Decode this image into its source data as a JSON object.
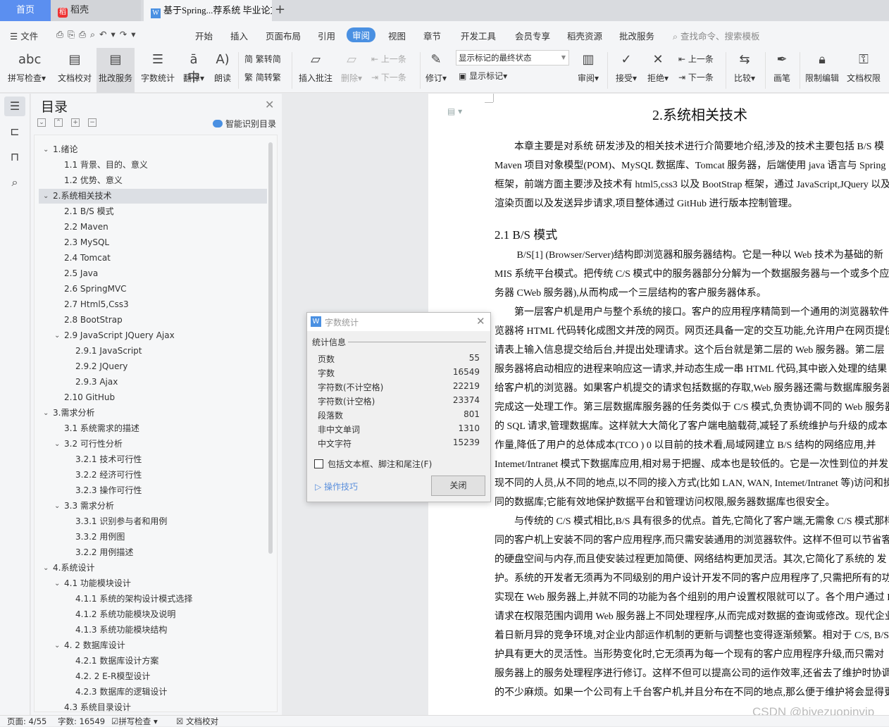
{
  "tabs": {
    "home": "首页",
    "daoke": "稻壳",
    "doc": "基于Spring...荐系统 毕业论文",
    "new": "+"
  },
  "menu": {
    "file": "文件",
    "items": [
      "开始",
      "插入",
      "页面布局",
      "引用",
      "审阅",
      "视图",
      "章节",
      "开发工具",
      "会员专享",
      "稻壳资源",
      "批改服务"
    ],
    "active": "审阅",
    "search": "查找命令、搜索模板"
  },
  "ribbon": {
    "spell": "拼写检查",
    "proof": "文档校对",
    "correct": "批改服务",
    "wordcount": "字数统计",
    "translate": "翻译",
    "read": "朗读",
    "t2s": "繁转简",
    "s2t": "简转繁",
    "insert_comment": "插入批注",
    "delete": "删除",
    "prev_c": "上一条",
    "next_c": "下一条",
    "revise": "修订",
    "markup_state": "显示标记的最终状态",
    "show_markup": "显示标记",
    "review": "审阅",
    "accept": "接受",
    "reject": "拒绝",
    "prev": "上一条",
    "next": "下一条",
    "compare": "比较",
    "pen": "画笔",
    "restrict": "限制编辑",
    "permission": "文档权限"
  },
  "toc": {
    "title": "目录",
    "smart": "智能识别目录",
    "items": [
      {
        "label": "1.绪论",
        "level": 1,
        "expanded": true
      },
      {
        "label": "1.1  背景、目的、意义",
        "level": 2
      },
      {
        "label": "1.2  优势、意义",
        "level": 2
      },
      {
        "label": "2.系统相关技术",
        "level": 1,
        "expanded": true,
        "selected": true
      },
      {
        "label": "2.1 B/S 模式",
        "level": 2
      },
      {
        "label": "2.2 Maven",
        "level": 2
      },
      {
        "label": "2.3 MySQL",
        "level": 2
      },
      {
        "label": "2.4 Tomcat",
        "level": 2
      },
      {
        "label": "2.5 Java",
        "level": 2
      },
      {
        "label": "2.6 SpringMVC",
        "level": 2
      },
      {
        "label": "2.7 Html5,Css3",
        "level": 2
      },
      {
        "label": "2.8 BootStrap",
        "level": 2
      },
      {
        "label": "2.9 JavaScript   JQuery    Ajax",
        "level": 2,
        "expanded": true
      },
      {
        "label": "2.9.1 JavaScript",
        "level": 3
      },
      {
        "label": "2.9.2 JQuery",
        "level": 3
      },
      {
        "label": "2.9.3 Ajax",
        "level": 3
      },
      {
        "label": "2.10 GitHub",
        "level": 2
      },
      {
        "label": "3.需求分析",
        "level": 1,
        "expanded": true
      },
      {
        "label": "3.1  系统需求的描述",
        "level": 2
      },
      {
        "label": "3.2  可行性分析",
        "level": 2,
        "expanded": true
      },
      {
        "label": "3.2.1 技术可行性",
        "level": 3
      },
      {
        "label": "3.2.2 经济可行性",
        "level": 3
      },
      {
        "label": "3.2.3 操作可行性",
        "level": 3
      },
      {
        "label": "3.3  需求分析",
        "level": 2,
        "expanded": true
      },
      {
        "label": "3.3.1  识别参与者和用例",
        "level": 3
      },
      {
        "label": "3.3.2  用例图",
        "level": 3
      },
      {
        "label": "3.2.2 用例描述",
        "level": 3
      },
      {
        "label": "4.系统设计",
        "level": 1,
        "expanded": true
      },
      {
        "label": "4.1 功能模块设计",
        "level": 2,
        "expanded": true
      },
      {
        "label": "4.1.1 系统的架构设计模式选择",
        "level": 3
      },
      {
        "label": "4.1.2 系统功能模块及说明",
        "level": 3
      },
      {
        "label": "4.1.3 系统功能模块结构",
        "level": 3
      },
      {
        "label": "4. 2 数据库设计",
        "level": 2,
        "expanded": true
      },
      {
        "label": "4.2.1 数据库设计方案",
        "level": 3
      },
      {
        "label": "4.2. 2 E-R模型设计",
        "level": 3
      },
      {
        "label": "4.2.3 数据库的逻辑设计",
        "level": 3
      },
      {
        "label": "4.3  系统目录设计",
        "level": 2
      }
    ]
  },
  "document": {
    "title": "2.系统相关技术",
    "section": "2.1 B/S 模式",
    "para1": [
      "　　本章主要是对系统  研发涉及的相关技术进行介简要地介绍,涉及的技术主要包括  B/S  模",
      "Maven 项目对象模型(POM)、MySQL 数据库、Tomcat 服务器，后端使用 java 语言与  Spring",
      "框架，前端方面主要涉及技术有 html5,css3 以及 BootStrap 框架，通过 JavaScript,JQuery 以及",
      "渲染页面以及发送异步请求,项目整体通过 GitHub 进行版本控制管理。"
    ],
    "para2": [
      "　　 B/S[1] (Browser/Server)结构即浏览器和服务器结构。它是一种以 Web 技术为基础的新",
      "MIS 系统平台模式。把传统 C/S 模式中的服务器部分分解为一个数据服务器与一个或多个应",
      "务器 CWeb 服务器),从而构成一个三层结构的客户服务器体系。",
      "　　第一层客户机是用户与整个系统的接口。客户的应用程序精简到一个通用的浏览器软件",
      "览器将 HTML 代码转化成图文并茂的网页。网页还具备一定的交互功能,允许用户在网页提供",
      "请表上输入信息提交给后台,并提出处理请求。这个后台就是第二层的 Web 服务器。第二层",
      "服务器将启动相应的进程来响应这一请求,并动态生成一串 HTML 代码,其中嵌入处理的结果",
      "给客户机的浏览器。如果客户机提交的请求包括数据的存取,Web 服务器还需与数据库服务器",
      "完成这一处理工作。第三层数据库服务器的任务类似于 C/S 模式,负责协调不同的 Web 服务器",
      "的 SQL 请求,管理数据库。这样就大大简化了客户端电脑载荷,减轻了系统维护与升级的成本",
      "作量,降低了用户的总体成本(TCO ) 0 以目前的技术看,局域网建立 B/S 结构的网络应用,并",
      "Intemet/Intranet 模式下数据库应用,相对易于把握、成本也是较低的。它是一次性到位的并发",
      "现不同的人员,从不同的地点,以不同的接入方式(比如 LAN, WAN, Intemet/Intranet 等)访问和操",
      "同的数据库;它能有效地保护数据平台和管理访问权限,服务器数据库也很安全。",
      "　　与传统的 C/S 模式相比,B/S 具有很多的优点。首先,它简化了客户端,无需象 C/S 模式那样",
      "同的客户机上安装不同的客户应用程序,而只需安装通用的浏览器软件。这样不但可以节省客",
      "的硬盘空间与内存,而且使安装过程更加简便、网络结构更加灵活。其次,它简化了系统的  发",
      "护。系统的开发者无须再为不同级别的用户设计开发不同的客户应用程序了,只需把所有的功",
      "实现在 Web 服务器上,并就不同的功能为各个组别的用户设置权限就可以了。各个用户通过 HT",
      "请求在权限范围内调用 Web 服务器上不同处理程序,从而完成对数据的查询或修改。现代企业",
      "着日新月异的竞争环境,对企业内部运作机制的更新与调整也变得逐渐频繁。相对于 C/S, B/S",
      "护具有更大的灵活性。当形势变化时,它无须再为每一个现有的客户应用程序升级,而只需对",
      "服务器上的服务处理程序进行修订。这样不但可以提高公司的运作效率,还省去了维护时协调",
      "的不少麻烦。如果一个公司有上千台客户机,并且分布在不同的地点,那么便于维护将会显得更"
    ]
  },
  "dialog": {
    "title": "字数统计",
    "group": "统计信息",
    "rows": [
      {
        "label": "页数",
        "value": "55"
      },
      {
        "label": "字数",
        "value": "16549"
      },
      {
        "label": "字符数(不计空格)",
        "value": "22219"
      },
      {
        "label": "字符数(计空格)",
        "value": "23374"
      },
      {
        "label": "段落数",
        "value": "801"
      },
      {
        "label": "非中文单词",
        "value": "1310"
      },
      {
        "label": "中文字符",
        "value": "15239"
      }
    ],
    "checkbox": "包括文本框、脚注和尾注(F)",
    "checked": false,
    "tips": "操作技巧",
    "close": "关闭"
  },
  "status": {
    "page": "页面: 4/55",
    "words": "字数: 16549",
    "spell": "拼写检查",
    "proof": "文档校对"
  },
  "watermark": "CSDN @biyezuopinvip"
}
